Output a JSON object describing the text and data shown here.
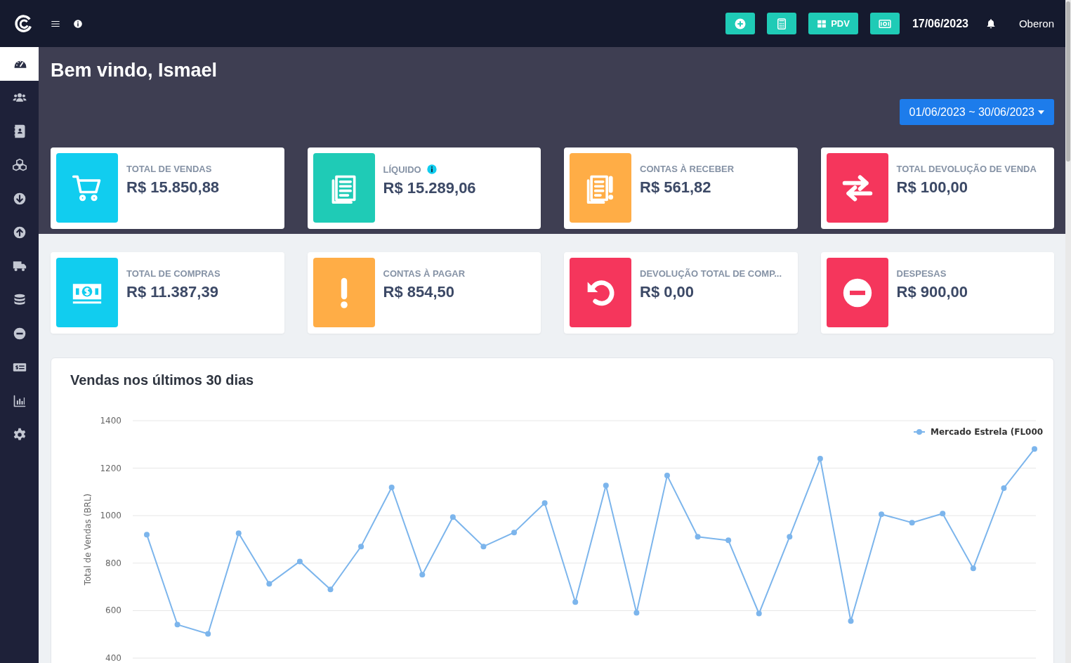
{
  "topbar": {
    "buttons": [
      {
        "kind": "add"
      },
      {
        "kind": "calculator"
      },
      {
        "kind": "pdv",
        "label": "PDV"
      },
      {
        "kind": "cash"
      }
    ],
    "date": "17/06/2023",
    "user": "Oberon"
  },
  "sidebar": {
    "items": [
      {
        "kind": "dashboard",
        "selected": true
      },
      {
        "kind": "users",
        "selected": false
      },
      {
        "kind": "contacts",
        "selected": false
      },
      {
        "kind": "boxes",
        "selected": false
      },
      {
        "kind": "down",
        "selected": false
      },
      {
        "kind": "up",
        "selected": false
      },
      {
        "kind": "truck",
        "selected": false
      },
      {
        "kind": "database",
        "selected": false
      },
      {
        "kind": "minus",
        "selected": false
      },
      {
        "kind": "cash",
        "selected": false
      },
      {
        "kind": "chart",
        "selected": false
      },
      {
        "kind": "settings",
        "selected": false
      }
    ]
  },
  "header": {
    "title": "Bem vindo, Ismael",
    "date_range": "01/06/2023 ~ 30/06/2023"
  },
  "cards": [
    {
      "kind": "cart",
      "color": "#11cdef",
      "label": "TOTAL DE VENDAS",
      "info": false,
      "value": "R$ 15.850,88"
    },
    {
      "kind": "document",
      "color": "#1fcbb6",
      "label": "LÍQUIDO",
      "info": true,
      "value": "R$ 15.289,06"
    },
    {
      "kind": "document-alert",
      "color": "#ffad46",
      "label": "CONTAS À RECEBER",
      "info": false,
      "value": "R$ 561,82"
    },
    {
      "kind": "swap",
      "color": "#f5365c",
      "label": "TOTAL DEVOLUÇÃO DE VENDA",
      "info": false,
      "value": "R$ 100,00"
    },
    {
      "kind": "bill",
      "color": "#11cdef",
      "label": "TOTAL DE COMPRAS",
      "info": false,
      "value": "R$ 11.387,39"
    },
    {
      "kind": "exclamation",
      "color": "#ffad46",
      "label": "CONTAS À PAGAR",
      "info": false,
      "value": "R$ 854,50"
    },
    {
      "kind": "undo",
      "color": "#f5365c",
      "label": "DEVOLUÇÃO TOTAL DE COMP...",
      "info": false,
      "value": "R$ 0,00"
    },
    {
      "kind": "minus",
      "color": "#f5365c",
      "label": "DESPESAS",
      "info": false,
      "value": "R$ 900,00"
    }
  ],
  "chart": {
    "title": "Vendas nos últimos 30 dias",
    "chart_data": {
      "type": "line",
      "grid": true,
      "ylabel": "Total de Vendas (BRL)",
      "ylim": [
        400,
        1400
      ],
      "yticks": [
        400,
        600,
        800,
        1000,
        1200,
        1400
      ],
      "series": [
        {
          "name": "Mercado Estrela (FL000",
          "color": "#7cb5ec",
          "marker": true,
          "values": [
            920,
            541,
            502,
            926,
            713,
            807,
            689,
            870,
            1119,
            751,
            994,
            870,
            929,
            1053,
            636,
            1127,
            591,
            1169,
            911,
            896,
            588,
            911,
            1240,
            556,
            1006,
            970,
            1009,
            778,
            1116,
            1281
          ]
        }
      ]
    }
  }
}
